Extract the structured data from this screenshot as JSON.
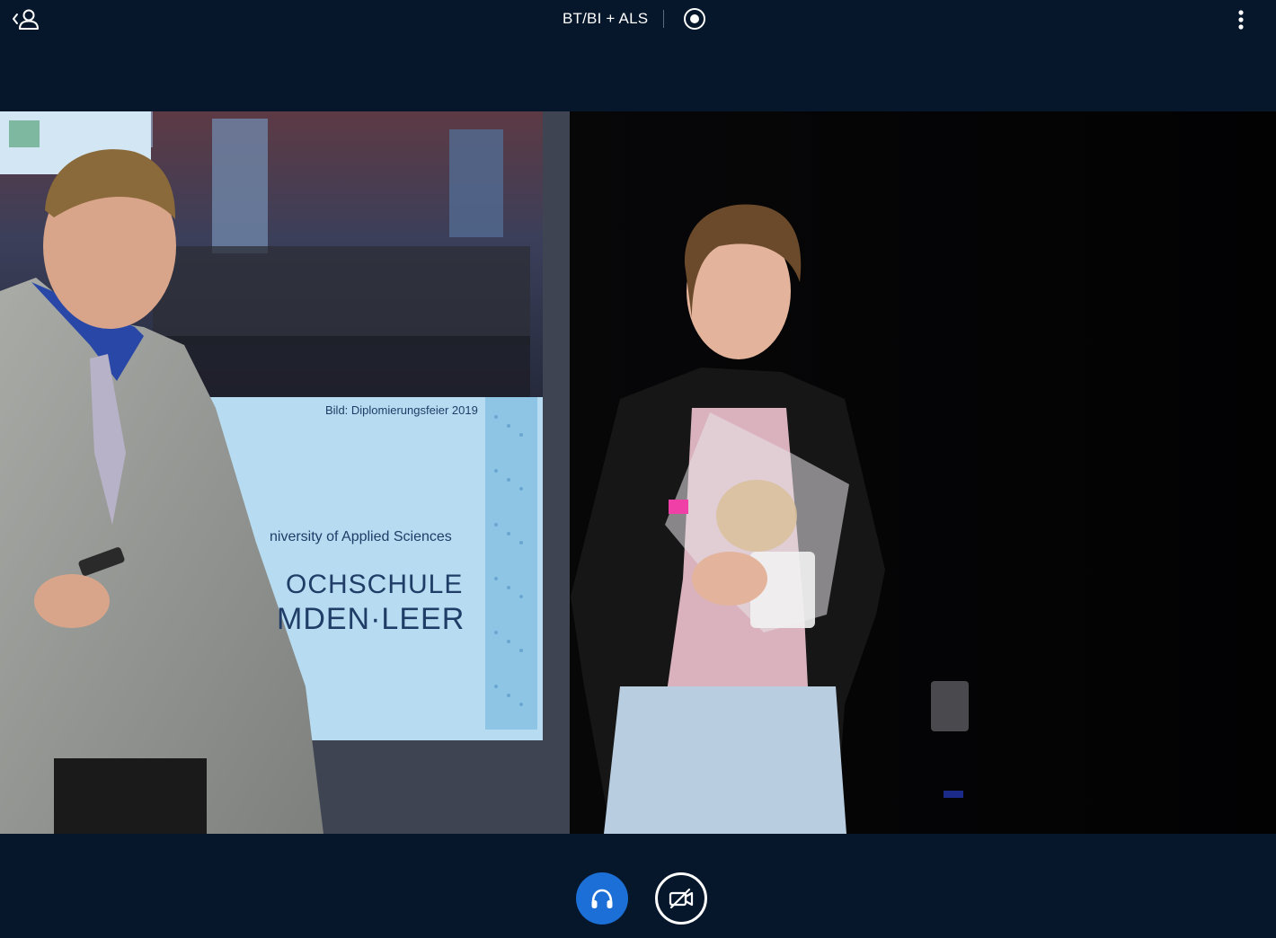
{
  "header": {
    "title": "BT/BI + ALS",
    "users_icon": "user-list-toggle-icon",
    "record_icon": "record-icon",
    "options_icon": "vertical-dots-icon"
  },
  "slide": {
    "caption": "Bild: Diplomierungsfeier 2019",
    "university_line": "niversity of Applied Sciences",
    "brand_line_1": "OCHSCHULE",
    "brand_line_2": "MDEN·LEER"
  },
  "controls": {
    "audio_icon": "headphones-icon",
    "video_icon": "camera-off-icon"
  },
  "colors": {
    "background": "#06172b",
    "accent": "#1b6fd6",
    "text": "#ffffff"
  }
}
